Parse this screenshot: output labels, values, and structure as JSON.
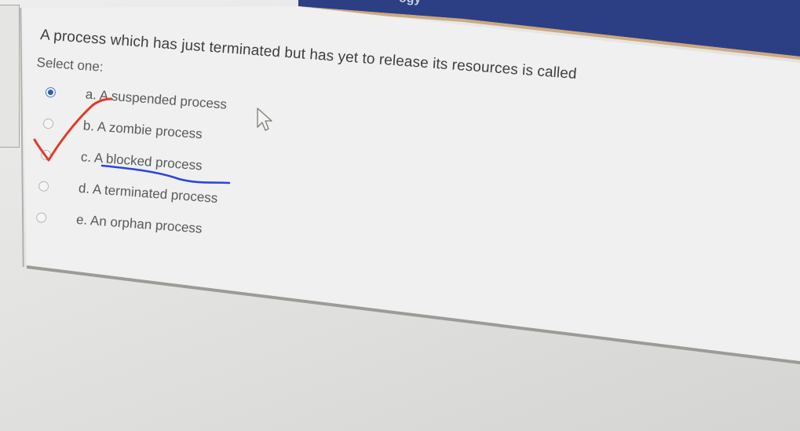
{
  "banner": {
    "partial_text": "ogy"
  },
  "quiz": {
    "question": "A process which has just terminated but has yet to release its resources is called",
    "prompt": "Select one:",
    "options": [
      {
        "label": "a. A suspended process",
        "selected": true
      },
      {
        "label": "b. A zombie process",
        "selected": false
      },
      {
        "label": "c. A blocked process",
        "selected": false
      },
      {
        "label": "d. A terminated process",
        "selected": false
      },
      {
        "label": "e. An orphan process",
        "selected": false
      }
    ]
  },
  "annotations": {
    "checkmark_color": "#e23a2a",
    "underline_color": "#2a45e0"
  },
  "colors": {
    "banner": "#2c3f85",
    "radio_selected": "#2f63a8",
    "text": "#4a4b4d"
  }
}
